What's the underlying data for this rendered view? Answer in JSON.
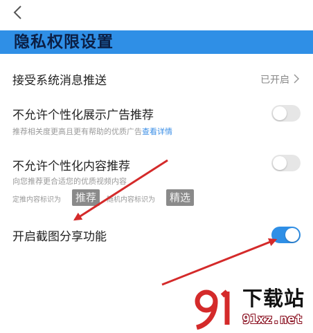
{
  "header": {
    "back_icon": "back-chevron-icon",
    "title": "隐私权限设置"
  },
  "colors": {
    "accent": "#2f8fe6",
    "toggle_off": "#e6e6e6",
    "link": "#3a8ee6",
    "annotation_arrow": "#d42a2a"
  },
  "settings": {
    "system_push": {
      "label": "接受系统消息推送",
      "status": "已开启"
    },
    "personalized_ads": {
      "label": "不允许个性化展示广告推荐",
      "description": "推荐相关度更高且更有帮助的优质广告",
      "link": "查看详情",
      "enabled": false
    },
    "personalized_content": {
      "label": "不允许个性化内容推荐",
      "description": "向您推荐更合适您的优质视频内容",
      "tag_prefix_1": "定推内容标识为",
      "tag_1": "推荐",
      "tag_prefix_2": "随机内容标识为",
      "tag_2": "精选",
      "enabled": false
    },
    "screenshot_share": {
      "label": "开启截图分享功能",
      "enabled": true
    }
  },
  "watermark": {
    "text": "下载站",
    "url": "91xz.net",
    "logo": "91-logo"
  }
}
